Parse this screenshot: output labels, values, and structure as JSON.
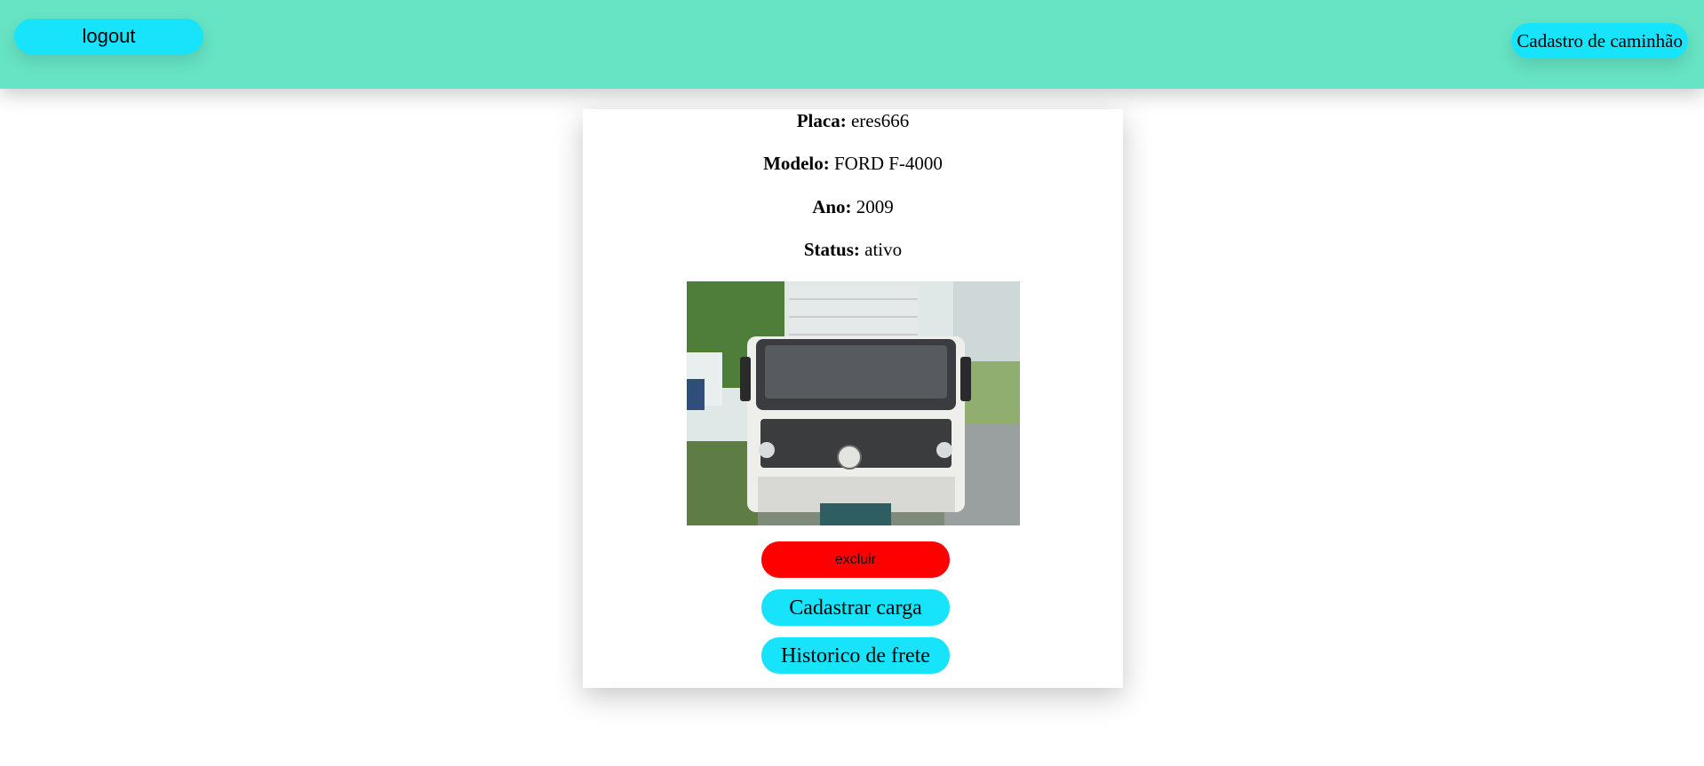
{
  "header": {
    "logout_label": "logout",
    "register_truck_label": "Cadastro de caminhão",
    "background_color": "#66e4c4",
    "button_color": "#17e4fb"
  },
  "truck": {
    "plate_label": "Placa:",
    "plate_value": "eres666",
    "model_label": "Modelo:",
    "model_value": "FORD F-4000",
    "year_label": "Ano:",
    "year_value": "2009",
    "status_label": "Status:",
    "status_value": "ativo",
    "photo_icon": "truck-photo"
  },
  "actions": {
    "delete_label": "excluir",
    "delete_color": "#ff0000",
    "register_cargo_label": "Cadastrar carga",
    "freight_history_label": "Historico de frete"
  }
}
